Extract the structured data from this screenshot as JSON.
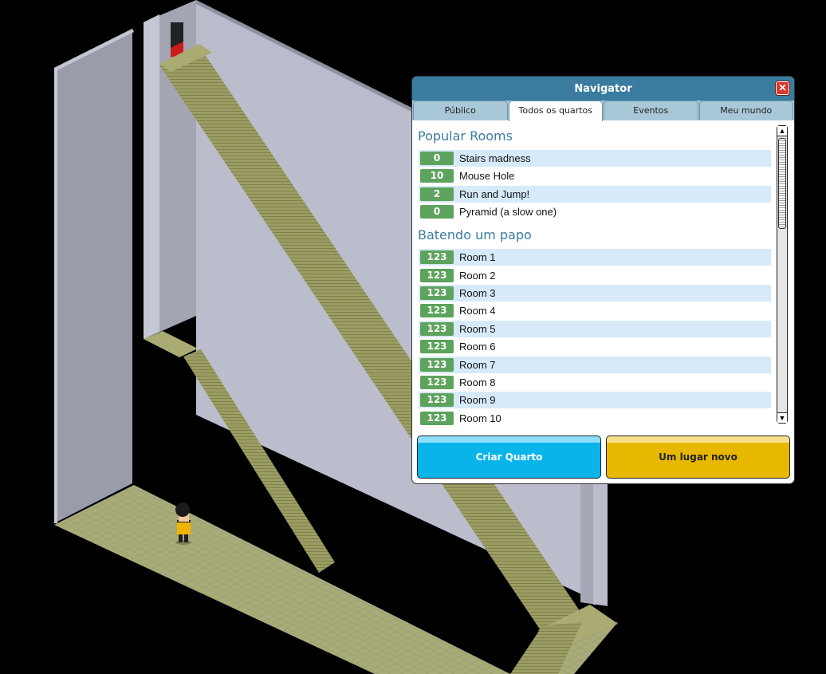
{
  "navigator": {
    "title": "Navigator",
    "close_label": "✕",
    "tabs": [
      {
        "label": "Público",
        "active": false
      },
      {
        "label": "Todos os quartos",
        "active": true
      },
      {
        "label": "Eventos",
        "active": false
      },
      {
        "label": "Meu mundo",
        "active": false
      }
    ],
    "sections": [
      {
        "title": "Popular Rooms",
        "rooms": [
          {
            "count": "0",
            "name": "Stairs madness"
          },
          {
            "count": "10",
            "name": "Mouse Hole"
          },
          {
            "count": "2",
            "name": "Run and Jump!"
          },
          {
            "count": "0",
            "name": "Pyramid (a slow one)"
          }
        ]
      },
      {
        "title": "Batendo um papo",
        "rooms": [
          {
            "count": "123",
            "name": "Room 1"
          },
          {
            "count": "123",
            "name": "Room 2"
          },
          {
            "count": "123",
            "name": "Room 3"
          },
          {
            "count": "123",
            "name": "Room 4"
          },
          {
            "count": "123",
            "name": "Room 5"
          },
          {
            "count": "123",
            "name": "Room 6"
          },
          {
            "count": "123",
            "name": "Room 7"
          },
          {
            "count": "123",
            "name": "Room 8"
          },
          {
            "count": "123",
            "name": "Room 9"
          },
          {
            "count": "123",
            "name": "Room 10"
          }
        ]
      }
    ],
    "scroll_up_icon": "▲",
    "scroll_down_icon": "▼",
    "buttons": {
      "create_label": "Criar Quarto",
      "new_place_label": "Um lugar novo"
    },
    "colors": {
      "header": "#3a7ca0",
      "badge": "#5da35d",
      "row_alt": "#d6eafa",
      "create_button": "#09b4ea",
      "new_place_button": "#e8b800"
    }
  },
  "scene": {
    "colors": {
      "wall_left": "#9a9caa",
      "wall_right": "#bcbdcc",
      "floor": "#a8aa78",
      "stairs": "#97995f"
    }
  }
}
